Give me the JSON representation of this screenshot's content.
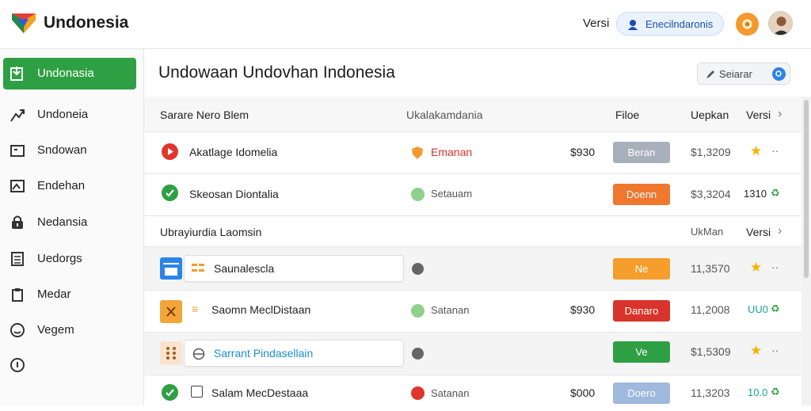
{
  "header": {
    "app_title": "Undonesia",
    "version_label": "Versi",
    "account_button": "Enecilndaronis"
  },
  "sidebar": {
    "items": [
      {
        "label": "Undonasia",
        "icon": "import-icon",
        "active": true
      },
      {
        "label": "Undoneia",
        "icon": "trend-icon"
      },
      {
        "label": "Sndowan",
        "icon": "folder-icon"
      },
      {
        "label": "Endehan",
        "icon": "image-icon"
      },
      {
        "label": "Nedansia",
        "icon": "lock-icon"
      },
      {
        "label": "Uedorgs",
        "icon": "table-icon"
      },
      {
        "label": "Medar",
        "icon": "clipboard-icon"
      },
      {
        "label": "Vegem",
        "icon": "smile-icon"
      },
      {
        "label": "",
        "icon": "info-icon"
      }
    ]
  },
  "main": {
    "title": "Undowaan Undovhan Indonesia",
    "search_label": "Seiarar"
  },
  "table": {
    "headers": {
      "name": "Sarare Nero Blem",
      "category": "Ukalakamdania",
      "files": "Filoe",
      "updated": "Uepkan",
      "version": "Versi"
    },
    "rows": [
      {
        "name": "Akatlage Idomelia",
        "category": "Emanan",
        "amount": "$930",
        "status": "Beran",
        "price": "$1,3209",
        "extra": ""
      },
      {
        "name": "Skeosan Diontalia",
        "category": "Setauam",
        "amount": "",
        "status": "Doenn",
        "price": "$3,3204",
        "extra": "1310"
      }
    ],
    "subheader": {
      "name": "Ubrayiurdia Laomsin",
      "updated": "UkMan",
      "version": "Versi"
    },
    "rows2": [
      {
        "name": "Saunalescla",
        "category": "",
        "amount": "",
        "status": "Ne",
        "price": "11,3570",
        "extra": ""
      },
      {
        "name": "Saomn MeclDistaan",
        "category": "Satanan",
        "amount": "$930",
        "status": "Danaro",
        "price": "11,2008",
        "extra": "UU0"
      },
      {
        "name": "Sarrant Pindasellain",
        "category": "",
        "amount": "",
        "status": "Ve",
        "price": "$1,5309",
        "extra": ""
      },
      {
        "name": "Salam MecDestaaa",
        "category": "Satanan",
        "amount": "$000",
        "status": "Doero",
        "price": "11,3203",
        "extra": "10.0"
      }
    ]
  },
  "colors": {
    "accent_green": "#2ea043",
    "status_gray": "#a8b0bc",
    "status_orange": "#f0772e",
    "status_amber": "#f59e2b",
    "status_red": "#d9342b",
    "status_green": "#2ea043",
    "status_blue": "#9fb8dd"
  }
}
